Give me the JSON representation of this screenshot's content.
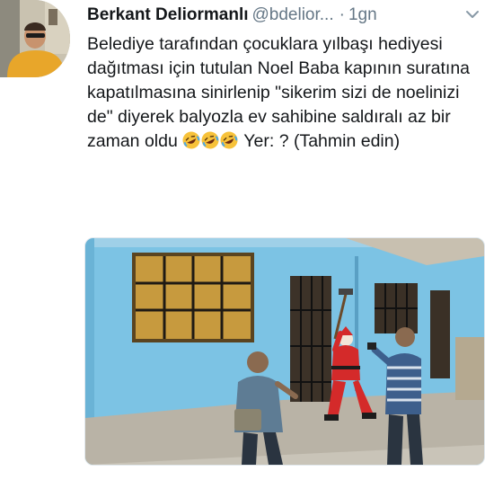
{
  "tweet": {
    "author_name": "Berkant Deliormanlı",
    "author_handle": "@bdelior...",
    "separator": "·",
    "time": "1gn",
    "text_main": "Belediye tarafından çocuklara yılbaşı hediyesi dağıtması için tutulan Noel Baba kapının suratına kapatılmasına sinirlenip \"sikerim sizi de noelinizi de\" diyerek balyozla ev sahibine saldıralı az bir zaman oldu ",
    "text_tail": " Yer: ? (Tahmin edin)",
    "emojis": [
      "rolling-on-floor-laughing-emoji",
      "rolling-on-floor-laughing-emoji",
      "rolling-on-floor-laughing-emoji"
    ]
  },
  "icons": {
    "more": "chevron-down-icon"
  },
  "colors": {
    "text": "#14171a",
    "muted": "#657786",
    "wall": "#7cc3e4",
    "santa_red": "#d42a2a"
  }
}
